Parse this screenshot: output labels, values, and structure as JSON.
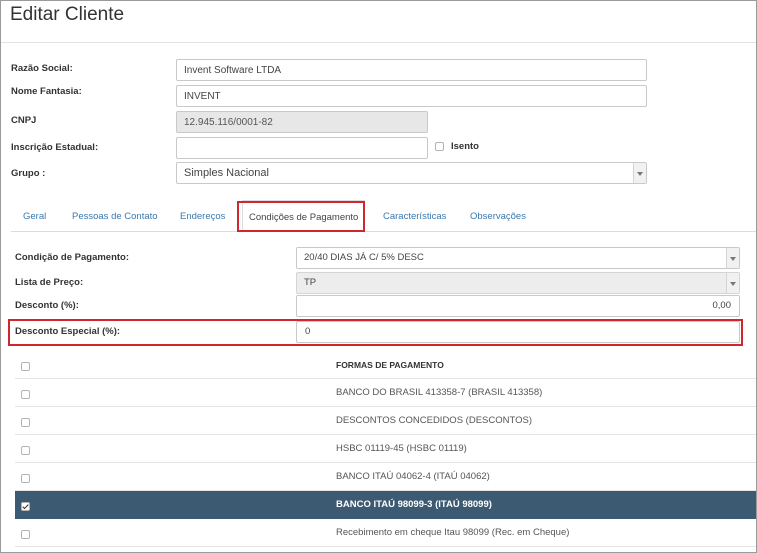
{
  "page": {
    "title": "Editar Cliente"
  },
  "form": {
    "razao_social": {
      "label": "Razão Social:",
      "value": "Invent Software LTDA"
    },
    "nome_fantasia": {
      "label": "Nome Fantasia:",
      "value": "INVENT"
    },
    "cnpj": {
      "label": "CNPJ",
      "value": "12.945.116/0001-82"
    },
    "inscricao_estadual": {
      "label": "Inscrição Estadual:",
      "value": ""
    },
    "isento": {
      "label": "Isento",
      "checked": false
    },
    "grupo": {
      "label": "Grupo :",
      "value": "Simples Nacional"
    }
  },
  "tabs": [
    {
      "label": "Geral",
      "active": false
    },
    {
      "label": "Pessoas de Contato",
      "active": false
    },
    {
      "label": "Endereços",
      "active": false
    },
    {
      "label": "Condições de Pagamento",
      "active": true
    },
    {
      "label": "Características",
      "active": false
    },
    {
      "label": "Observações",
      "active": false
    }
  ],
  "payment": {
    "condicao": {
      "label": "Condição de Pagamento:",
      "value": "20/40 DIAS JÁ C/ 5% DESC"
    },
    "lista_preco": {
      "label": "Lista de Preço:",
      "value": "TP"
    },
    "desconto": {
      "label": "Desconto (%):",
      "value": "0,00"
    },
    "desconto_especial": {
      "label": "Desconto Especial (%):",
      "value": "0"
    }
  },
  "formas": {
    "header": "FORMAS DE PAGAMENTO",
    "rows": [
      {
        "label": "BANCO DO BRASIL 413358-7 (BRASIL 413358)",
        "checked": false
      },
      {
        "label": "DESCONTOS CONCEDIDOS (DESCONTOS)",
        "checked": false
      },
      {
        "label": "HSBC 01119-45 (HSBC 01119)",
        "checked": false
      },
      {
        "label": "BANCO ITAÚ 04062-4 (ITAÚ 04062)",
        "checked": false
      },
      {
        "label": "BANCO ITAÚ 98099-3 (ITAÚ 98099)",
        "checked": true
      },
      {
        "label": "Recebimento em cheque Itau 98099 (Rec. em Cheque)",
        "checked": false
      }
    ]
  },
  "colors": {
    "highlight": "#d0262e",
    "selected_row": "#3d5a73",
    "link": "#3a7ab0"
  }
}
